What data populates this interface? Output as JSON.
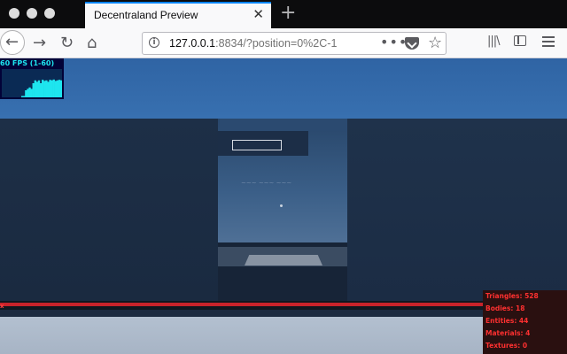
{
  "browser": {
    "tab": {
      "title": "Decentraland Preview",
      "close_glyph": "✕"
    },
    "new_tab_glyph": "+",
    "nav": {
      "back_glyph": "←",
      "forward_glyph": "→",
      "reload_glyph": "↻",
      "home_glyph": "⌂"
    },
    "url": {
      "host": "127.0.0.1",
      "rest": ":8834/?position=0%2C-1",
      "info_glyph": "i"
    },
    "toolbar": {
      "more_glyph": "•••",
      "star_glyph": "☆",
      "library_glyph": "|||\\"
    }
  },
  "fps_monitor": {
    "label": "60 FPS (1-60)",
    "history_fraction": [
      0.05,
      0.05,
      0.25,
      0.3,
      0.35,
      0.3,
      0.5,
      0.6,
      0.55,
      0.6,
      0.5,
      0.62,
      0.58,
      0.6,
      0.55,
      0.62,
      0.6,
      0.63,
      0.58,
      0.6,
      0.62,
      0.6
    ],
    "color": "#1ee5ef"
  },
  "scene": {
    "faint_label": "~~~ ~~~ ~~~"
  },
  "floor_bar_mark": "x",
  "stats": [
    {
      "label": "Triangles: 528"
    },
    {
      "label": "Bodies: 18"
    },
    {
      "label": "Entities: 44"
    },
    {
      "label": "Materials: 4"
    },
    {
      "label": "Textures: 0"
    }
  ],
  "colors": {
    "stats_text": "#ff3030",
    "tab_accent": "#0a84ff"
  }
}
